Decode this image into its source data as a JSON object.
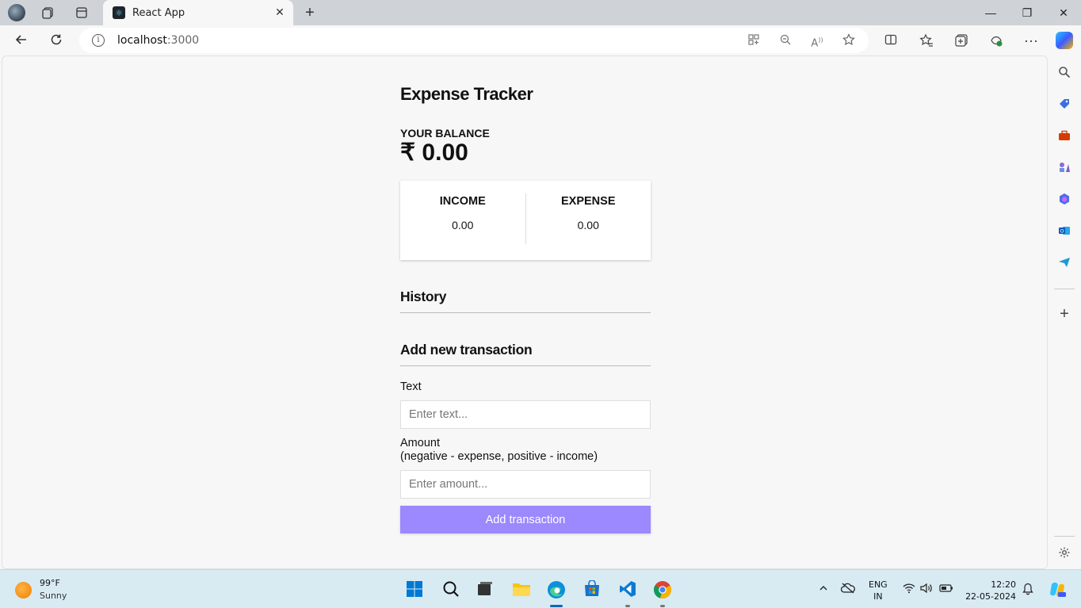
{
  "browser": {
    "tab_title": "React App",
    "tab_close": "✕",
    "new_tab": "+",
    "url_host": "localhost",
    "url_port": ":3000",
    "window_controls": {
      "minimize": "—",
      "restore": "❐",
      "close": "✕"
    }
  },
  "app": {
    "title": "Expense Tracker",
    "balance_label": "YOUR BALANCE",
    "balance_value": "₹ 0.00",
    "income_label": "INCOME",
    "income_value": "0.00",
    "expense_label": "EXPENSE",
    "expense_value": "0.00",
    "history_heading": "History",
    "add_heading": "Add new transaction",
    "text_label": "Text",
    "text_placeholder": "Enter text...",
    "amount_label": "Amount",
    "amount_hint": "(negative - expense, positive - income)",
    "amount_placeholder": "Enter amount...",
    "submit_label": "Add transaction",
    "accent_color": "#9c88ff"
  },
  "taskbar": {
    "weather_temp": "99°F",
    "weather_condition": "Sunny",
    "lang_line1": "ENG",
    "lang_line2": "IN",
    "time": "12:20",
    "date": "22-05-2024"
  }
}
